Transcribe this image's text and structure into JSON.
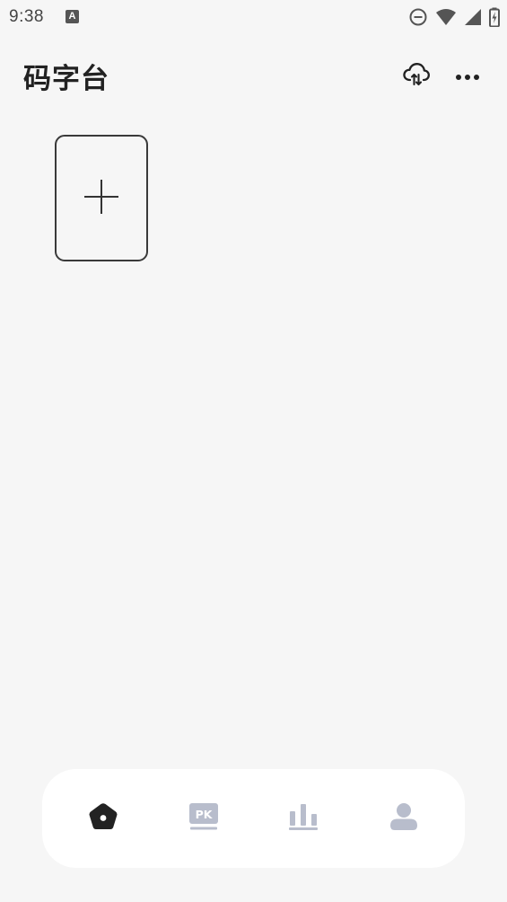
{
  "status_bar": {
    "time": "9:38",
    "notification_icon": "a-letter-icon",
    "notification_letter": "A",
    "icons": [
      "do-not-disturb-icon",
      "wifi-icon",
      "cellular-signal-icon",
      "battery-charging-icon"
    ]
  },
  "header": {
    "title": "码字台",
    "cloud_icon": "cloud-sync-icon",
    "more_icon": "more-horizontal-icon"
  },
  "main": {
    "add_card_icon": "plus-icon"
  },
  "bottom_nav": {
    "items": [
      {
        "icon": "home-icon",
        "active": true
      },
      {
        "icon": "pk-icon",
        "label": "PK",
        "active": false
      },
      {
        "icon": "chart-icon",
        "active": false
      },
      {
        "icon": "profile-icon",
        "active": false
      }
    ]
  },
  "colors": {
    "background": "#f6f6f6",
    "active_icon": "#222222",
    "inactive_icon": "#b8bdcc",
    "nav_background": "#ffffff"
  }
}
